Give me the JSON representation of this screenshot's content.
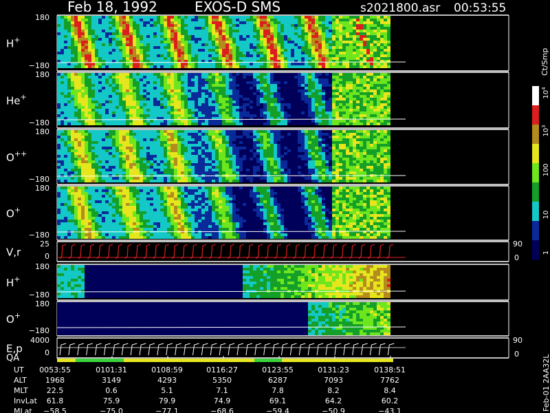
{
  "header": {
    "date": "Feb 18, 1992",
    "mission": "EXOS-D SMS",
    "file": "s2021800.asr",
    "time": "00:53:55"
  },
  "side_label": "Feb-01 2AA32L",
  "colorbar": {
    "unit": "Ct/Smp",
    "ticks": [
      "1",
      "10",
      "100",
      "10",
      "10"
    ],
    "tick_exp": [
      "",
      "",
      "",
      "3",
      "4"
    ]
  },
  "panels": [
    {
      "id": "h-plus",
      "label": "H",
      "sup": "+",
      "ymax": "180",
      "ymin": "−180"
    },
    {
      "id": "he-plus",
      "label": "He",
      "sup": "+",
      "ymax": "180",
      "ymin": "−180"
    },
    {
      "id": "o-plus2",
      "label": "O",
      "sup": "++",
      "ymax": "180",
      "ymin": "−180"
    },
    {
      "id": "o-plus",
      "label": "O",
      "sup": "+",
      "ymax": "180",
      "ymin": "−180"
    },
    {
      "id": "vr",
      "label": "V,r",
      "sup": "",
      "ymax": "25",
      "ymin": "0",
      "right_max": "90",
      "right_min": "0"
    },
    {
      "id": "h-plus-b",
      "label": "H",
      "sup": "+",
      "ymax": "180",
      "ymin": "−180"
    },
    {
      "id": "o-plus-b",
      "label": "O",
      "sup": "+",
      "ymax": "180",
      "ymin": "−180"
    },
    {
      "id": "ep",
      "label": "E,p",
      "sup": "",
      "ymax": "4000",
      "ymin": "0",
      "right_max": "90",
      "right_min": "0"
    }
  ],
  "qa_label": "QA",
  "ephemeris": {
    "rows": [
      {
        "name": "UT",
        "values": [
          "0053:55",
          "0101:31",
          "0108:59",
          "0116:27",
          "0123:55",
          "0131:23",
          "0138:51"
        ]
      },
      {
        "name": "ALT",
        "values": [
          "1968",
          "3149",
          "4293",
          "5350",
          "6287",
          "7093",
          "7762"
        ]
      },
      {
        "name": "MLT",
        "values": [
          "22.5",
          "0.6",
          "5.1",
          "7.1",
          "7.8",
          "8.2",
          "8.4"
        ]
      },
      {
        "name": "InvLat",
        "values": [
          "61.8",
          "75.9",
          "79.9",
          "74.9",
          "69.1",
          "64.2",
          "60.2"
        ]
      },
      {
        "name": "MLat",
        "values": [
          "−58.5",
          "−75.0",
          "−77.1",
          "−68.6",
          "−59.4",
          "−50.9",
          "−43.1"
        ]
      }
    ]
  },
  "chart_data": {
    "type": "heatmap",
    "title": "Feb 18, 1992   EXOS-D SMS",
    "x": [
      "0053:55",
      "0101:31",
      "0108:59",
      "0116:27",
      "0123:55",
      "0131:23",
      "0138:51"
    ],
    "panels": [
      "H+",
      "He+",
      "O++",
      "O+",
      "V,r",
      "H+",
      "O+",
      "E,p"
    ],
    "colorbar": {
      "label": "Ct/Smp",
      "scale": "log",
      "range": [
        1,
        10000
      ],
      "colors": [
        "#00005a",
        "#0a2a9a",
        "#14c8c8",
        "#14a028",
        "#6ee61e",
        "#e6e61e",
        "#b48c1e",
        "#dc1e1e",
        "#ffffff"
      ]
    }
  }
}
